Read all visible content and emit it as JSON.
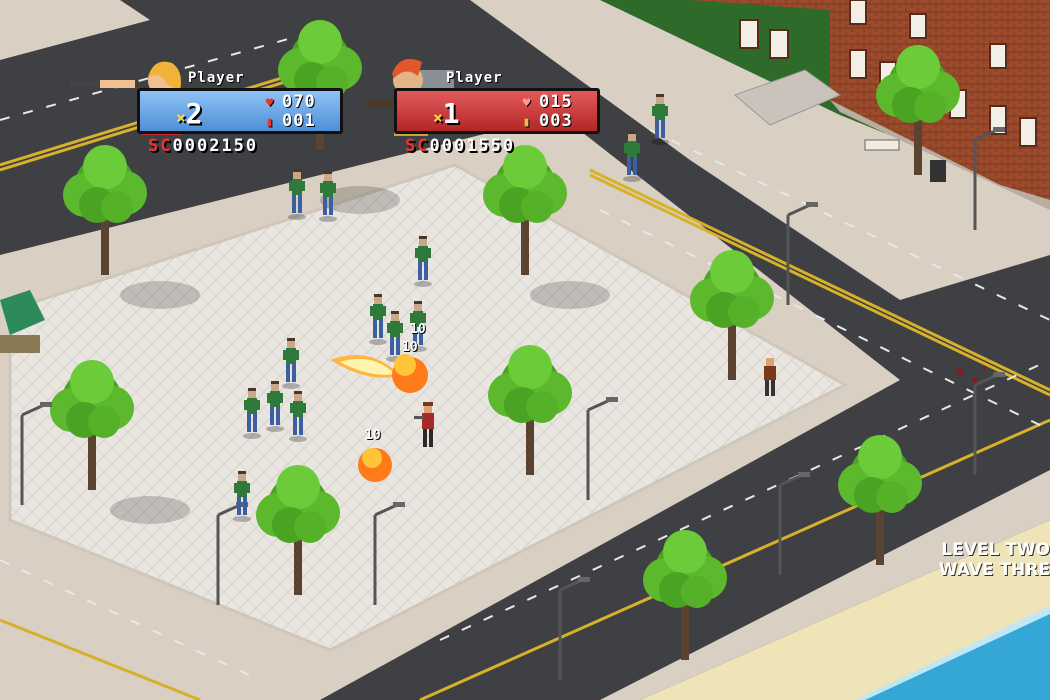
{
  "players": [
    {
      "name": "Player",
      "lives": "2",
      "health": "070",
      "ammo": "001",
      "score_prefix": "SC",
      "score": "0002150",
      "panel_color": "#5d9de0"
    },
    {
      "name": "Player",
      "lives": "1",
      "health": "015",
      "ammo": "003",
      "score_prefix": "SC",
      "score": "0001550",
      "panel_color": "#c93030"
    }
  ],
  "lives_prefix": "×",
  "wave": {
    "level": "LEVEL TWO",
    "wave": "WAVE THRE"
  },
  "damage_numbers": [
    "10",
    "10",
    "10"
  ],
  "icons": {
    "health": "heart-icon",
    "ammo": "ammo-icon"
  },
  "colors": {
    "road": "#3d3d3f",
    "plaza": "#e6e2dc",
    "sidewalk": "#d9cfc2",
    "tree": "#5cb82c",
    "building": "#9a4a2a",
    "water": "#35a7d6",
    "sand": "#efe3b8"
  }
}
